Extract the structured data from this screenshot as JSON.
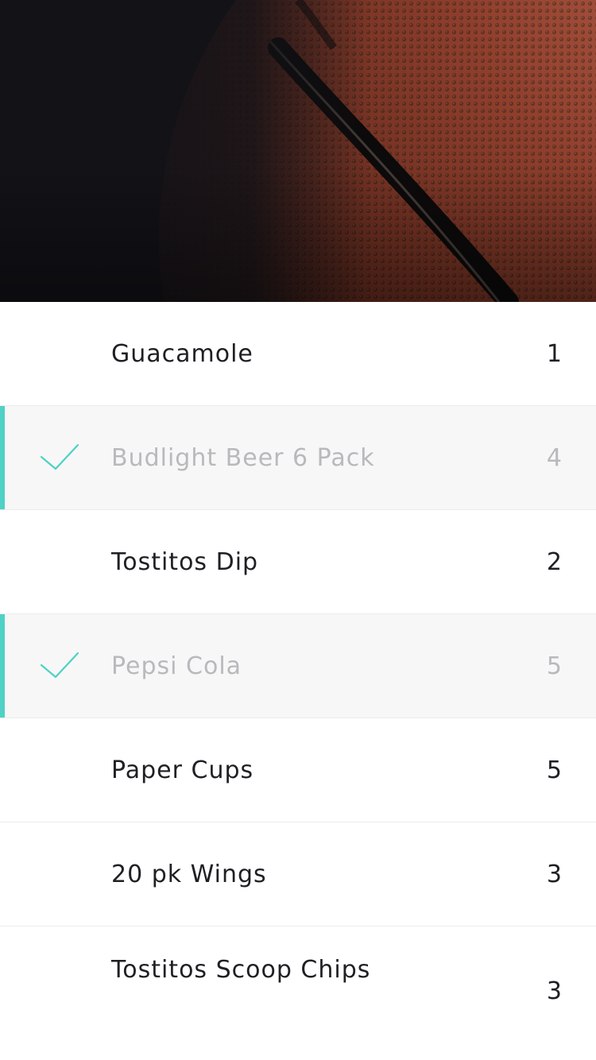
{
  "colors": {
    "accent": "#4fd1c5",
    "text": "#1f1f24",
    "muted": "#b9b9bd",
    "completed_row_bg": "#f7f7f7"
  },
  "hero": {
    "image": "basketball-closeup-image"
  },
  "items": [
    {
      "name": "Guacamole",
      "qty": "1",
      "checked": false
    },
    {
      "name": "Budlight Beer 6 Pack",
      "qty": "4",
      "checked": true
    },
    {
      "name": "Tostitos Dip",
      "qty": "2",
      "checked": false
    },
    {
      "name": "Pepsi Cola",
      "qty": "5",
      "checked": true
    },
    {
      "name": "Paper Cups",
      "qty": "5",
      "checked": false
    },
    {
      "name": "20 pk Wings",
      "qty": "3",
      "checked": false
    },
    {
      "name": "Tostitos Scoop Chips",
      "qty": "3",
      "checked": false
    }
  ]
}
